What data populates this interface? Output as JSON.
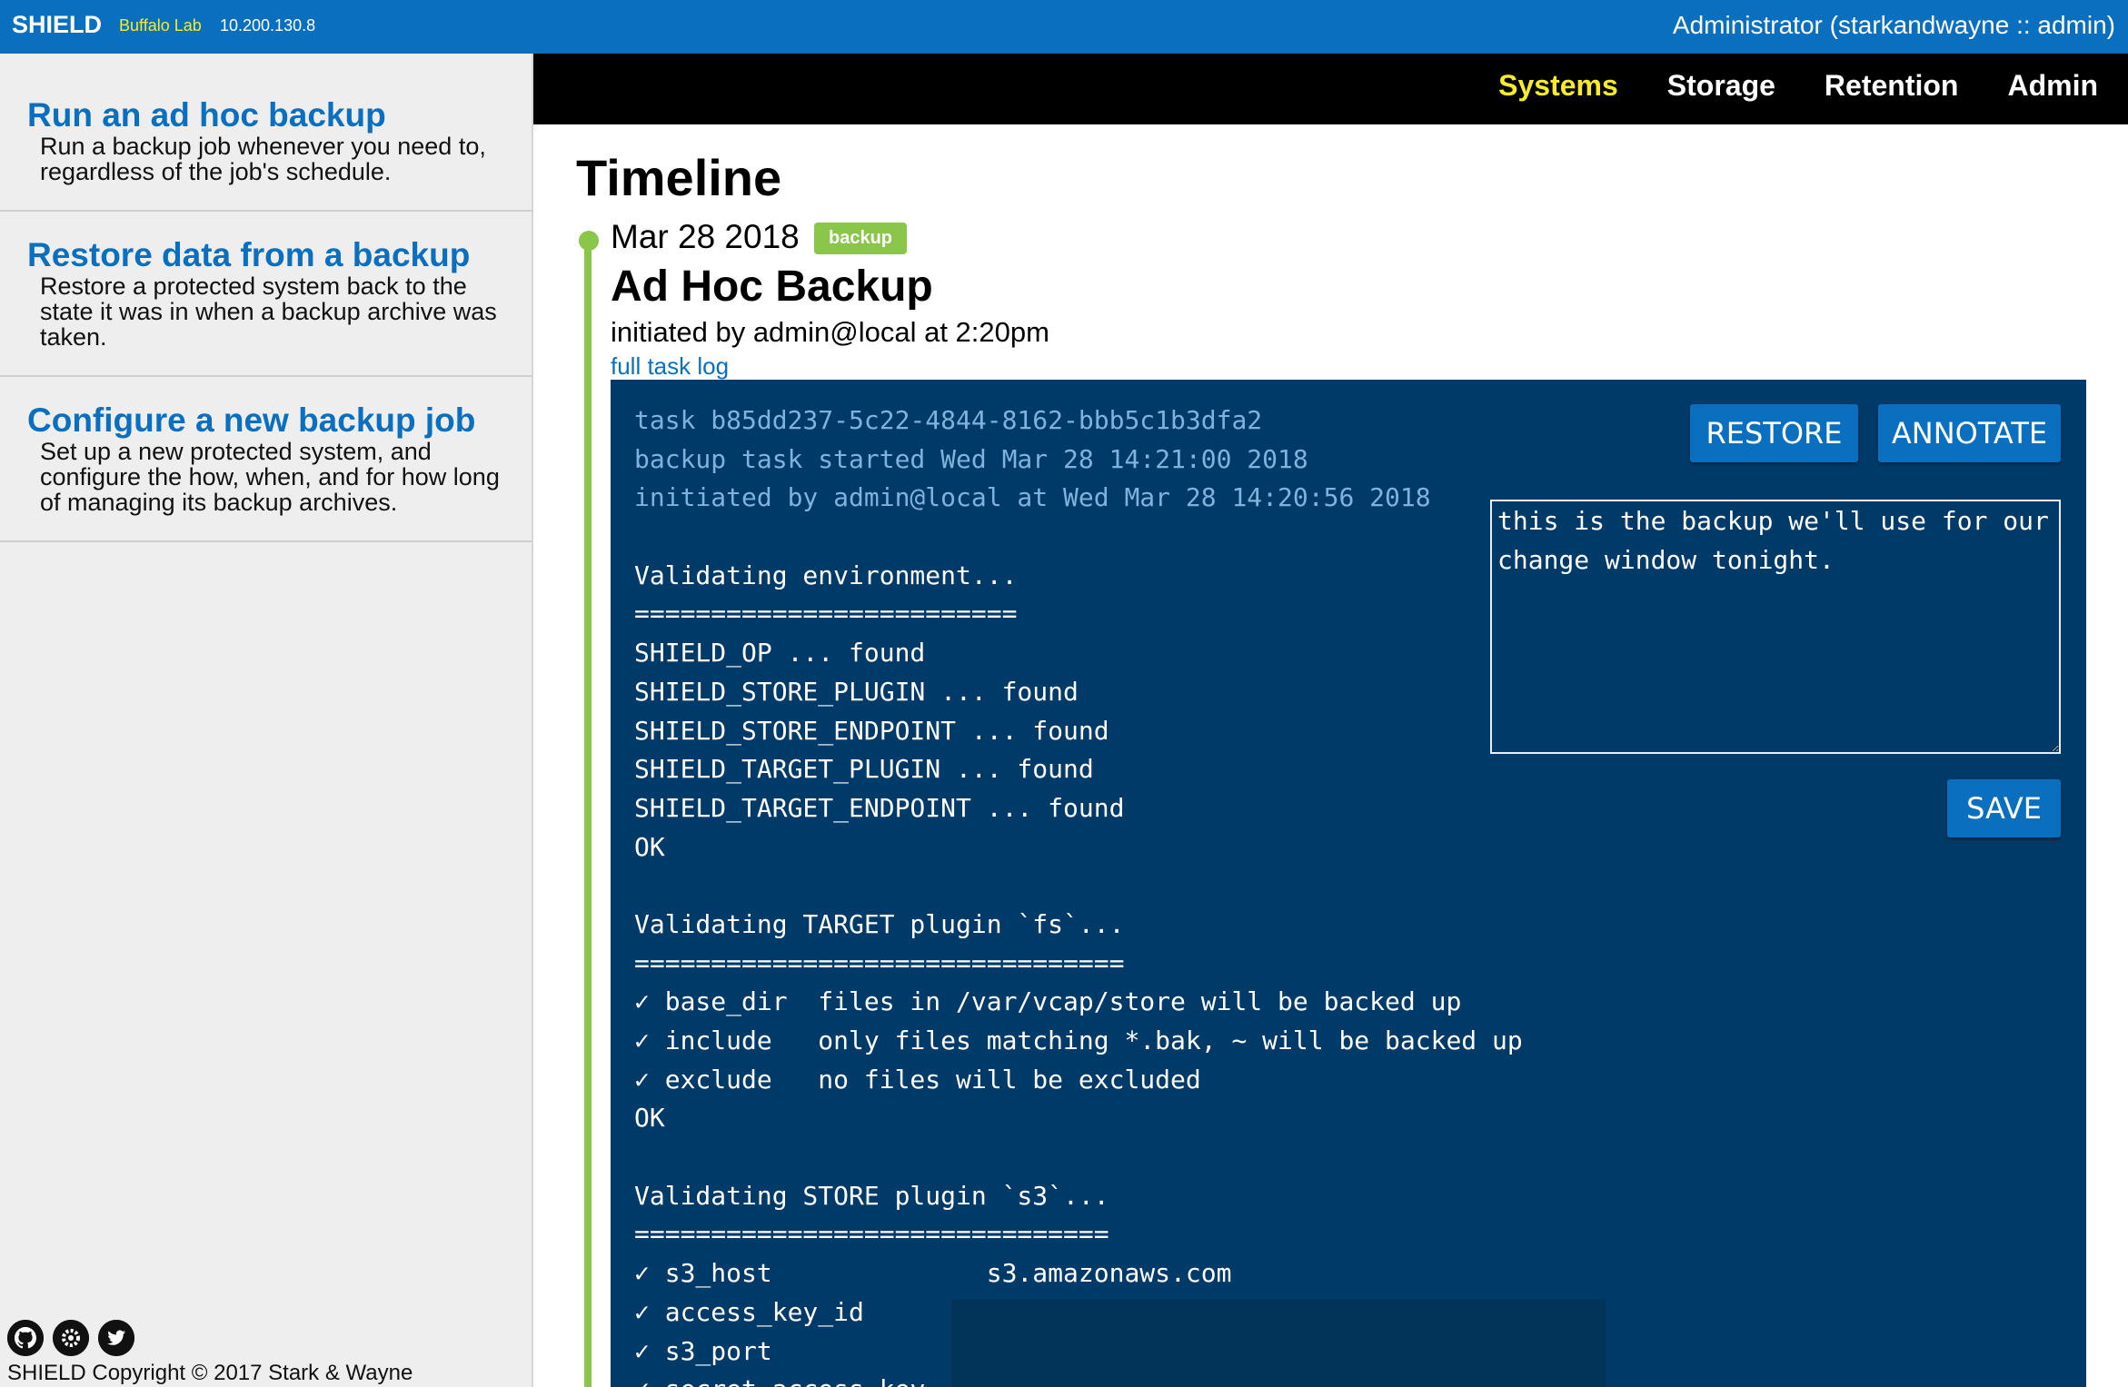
{
  "header": {
    "brand": "SHIELD",
    "environment": "Buffalo Lab",
    "ip": "10.200.130.8",
    "user": "Administrator (starkandwayne :: admin)"
  },
  "sidebar": {
    "items": [
      {
        "title": "Run an ad hoc backup",
        "description": "Run a backup job whenever you need to, regardless of the job's schedule."
      },
      {
        "title": "Restore data from a backup",
        "description": "Restore a protected system back to the state it was in when a backup archive was taken."
      },
      {
        "title": "Configure a new backup job",
        "description": "Set up a new protected system, and configure the how, when, and for how long of managing its backup archives."
      }
    ],
    "footer": {
      "icons": [
        "github-icon",
        "gear-icon",
        "twitter-icon"
      ],
      "copyright": "SHIELD Copyright © 2017 Stark & Wayne"
    }
  },
  "nav": {
    "items": [
      {
        "label": "Systems",
        "active": true
      },
      {
        "label": "Storage",
        "active": false
      },
      {
        "label": "Retention",
        "active": false
      },
      {
        "label": "Admin",
        "active": false
      }
    ]
  },
  "main": {
    "title": "Timeline",
    "entry": {
      "date": "Mar 28 2018",
      "tag": "backup",
      "title": "Ad Hoc Backup",
      "initiated": "initiated by admin@local at 2:20pm",
      "log_link": "full task log",
      "task": {
        "log": [
          {
            "text": "task b85dd237-5c22-4844-8162-bbb5c1b3dfa2",
            "kind": "meta"
          },
          {
            "text": "backup task started Wed Mar 28 14:21:00 2018",
            "kind": "meta"
          },
          {
            "text": "initiated by admin@local at Wed Mar 28 14:20:56 2018",
            "kind": "meta"
          },
          {
            "text": "",
            "kind": "blank"
          },
          {
            "text": "Validating environment...",
            "kind": "text"
          },
          {
            "text": "=========================",
            "kind": "rule"
          },
          {
            "text": "SHIELD_OP ... found",
            "kind": "text"
          },
          {
            "text": "SHIELD_STORE_PLUGIN ... found",
            "kind": "text"
          },
          {
            "text": "SHIELD_STORE_ENDPOINT ... found",
            "kind": "text"
          },
          {
            "text": "SHIELD_TARGET_PLUGIN ... found",
            "kind": "text"
          },
          {
            "text": "SHIELD_TARGET_ENDPOINT ... found",
            "kind": "text"
          },
          {
            "text": "OK",
            "kind": "text"
          },
          {
            "text": "",
            "kind": "blank"
          },
          {
            "text": "Validating TARGET plugin `fs`...",
            "kind": "text"
          },
          {
            "text": "================================",
            "kind": "rule"
          },
          {
            "text": "✓ base_dir  files in /var/vcap/store will be backed up",
            "kind": "text"
          },
          {
            "text": "✓ include   only files matching *.bak, ~ will be backed up",
            "kind": "text"
          },
          {
            "text": "✓ exclude   no files will be excluded",
            "kind": "text"
          },
          {
            "text": "OK",
            "kind": "text"
          },
          {
            "text": "",
            "kind": "blank"
          },
          {
            "text": "Validating STORE plugin `s3`...",
            "kind": "text"
          },
          {
            "text": "===============================",
            "kind": "rule"
          },
          {
            "text": "✓ s3_host              s3.amazonaws.com",
            "kind": "text"
          },
          {
            "text": "✓ access_key_id",
            "kind": "text"
          },
          {
            "text": "✓ s3_port",
            "kind": "text"
          },
          {
            "text": "✓ secret_access_key",
            "kind": "text"
          }
        ],
        "buttons": {
          "restore": "RESTORE",
          "annotate": "ANNOTATE",
          "save": "SAVE"
        },
        "annotation": "this is the backup we'll use for our change window tonight."
      }
    }
  },
  "colors": {
    "header_bg": "#0a6fbe",
    "nav_bg": "#000000",
    "nav_active": "#f7ec27",
    "panel_bg": "#003a68",
    "timeline": "#89c64a",
    "link": "#0a6fbe"
  }
}
